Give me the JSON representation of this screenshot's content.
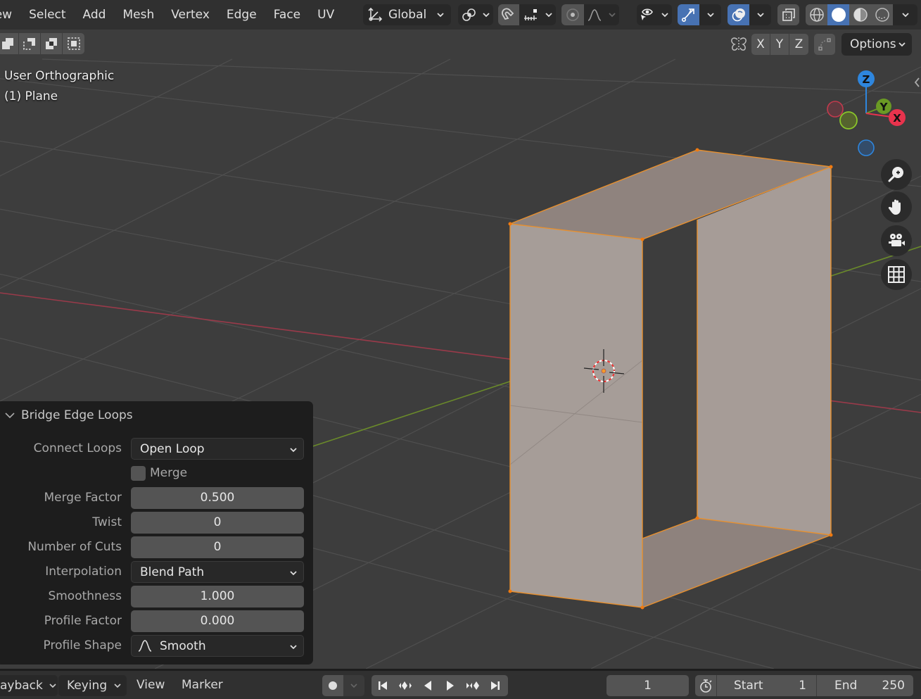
{
  "header": {
    "menu": [
      "View",
      "Select",
      "Add",
      "Mesh",
      "Vertex",
      "Edge",
      "Face",
      "UV"
    ],
    "menu_first_visible": "iew",
    "transform_orientation": "Global",
    "transform_orientation_icon": "orientation-axes-icon",
    "pivot_icon": "pivot-point-icon",
    "snap_icon": "snap-magnet-icon",
    "snap_target_icon": "snap-increment-icon",
    "proportional_icon": "proportional-edit-icon",
    "falloff_icon": "falloff-smooth-icon",
    "visibility_icon": "selectability-visibility-icon",
    "gizmo_icon": "gizmo-icon",
    "overlay_icon": "overlay-icon",
    "xray_icon": "xray-icon",
    "shading_modes": [
      "Wireframe",
      "Solid",
      "Material Preview",
      "Rendered"
    ],
    "shading_active": "Solid",
    "accent": "#4772b3"
  },
  "toolrow": {
    "select_modes": [
      "Vertex",
      "Edge",
      "Face",
      "Box select"
    ],
    "mirror_icon": "mirror-butterfly-icon",
    "axes": [
      "X",
      "Y",
      "Z"
    ],
    "auto_merge_icon": "auto-merge-icon",
    "options_label": "Options"
  },
  "viewport": {
    "view_name": "User Orthographic",
    "object_name": "(1) Plane",
    "gizmo": {
      "z": "Z",
      "y": "Y",
      "x": "X",
      "x_color": "#e8334d",
      "y_color": "#6a9a24",
      "z_color": "#2e86de"
    },
    "nav_buttons": [
      "zoom",
      "pan",
      "camera",
      "perspective-toggle"
    ],
    "selection_color": "#f08a1c",
    "mesh_face_color": "#a69c97"
  },
  "redo_panel": {
    "title": "Bridge Edge Loops",
    "props": [
      {
        "label": "Connect Loops",
        "value": "Open Loop",
        "type": "dropdown"
      },
      {
        "label": "Merge",
        "value": false,
        "type": "checkbox"
      },
      {
        "label": "Merge Factor",
        "value": "0.500",
        "type": "number"
      },
      {
        "label": "Twist",
        "value": "0",
        "type": "number"
      },
      {
        "label": "Number of Cuts",
        "value": "0",
        "type": "number"
      },
      {
        "label": "Interpolation",
        "value": "Blend Path",
        "type": "dropdown"
      },
      {
        "label": "Smoothness",
        "value": "1.000",
        "type": "number"
      },
      {
        "label": "Profile Factor",
        "value": "0.000",
        "type": "number"
      },
      {
        "label": "Profile Shape",
        "value": "Smooth",
        "type": "dropdown"
      }
    ]
  },
  "timeline": {
    "playback_label": "ayback",
    "keying_label": "Keying",
    "view_label": "View",
    "marker_label": "Marker",
    "current_frame": "1",
    "start_label": "Start",
    "start_value": "1",
    "end_label": "End",
    "end_value": "250"
  }
}
